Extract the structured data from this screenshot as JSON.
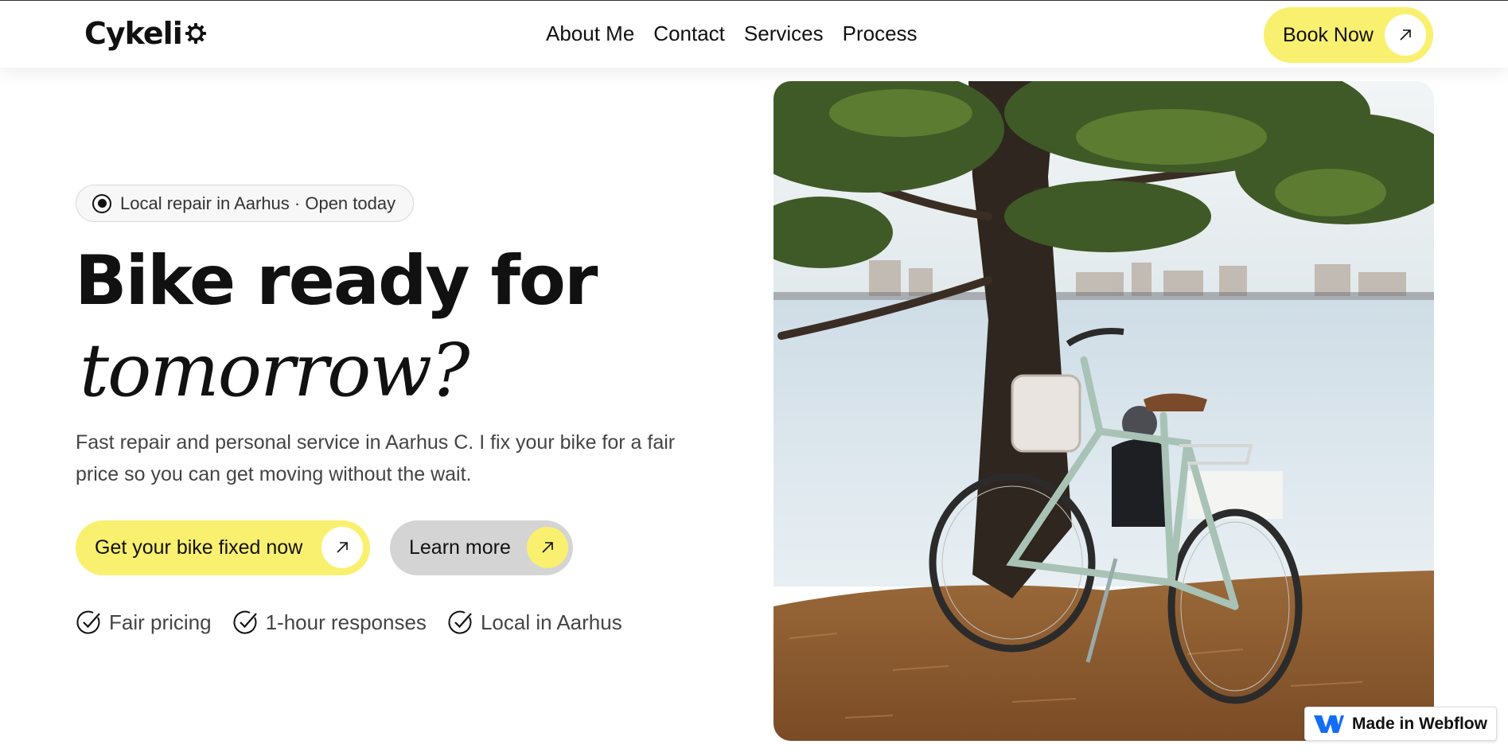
{
  "header": {
    "logo": "Cykeli",
    "nav": [
      "About Me",
      "Contact",
      "Services",
      "Process"
    ],
    "book_label": "Book Now"
  },
  "hero": {
    "pill_text": "Local repair in Aarhus · Open today",
    "title_line1": "Bike ready for",
    "title_line2": "tomorrow?",
    "description": "Fast repair and personal service in Aarhus C. I fix your bike for a fair price so you can get moving without the wait.",
    "cta_primary": "Get your bike fixed now",
    "cta_secondary": "Learn more",
    "features": [
      "Fair pricing",
      "1-hour responses",
      "Local in Aarhus"
    ]
  },
  "badge": {
    "label": "Made in Webflow"
  },
  "colors": {
    "accent": "#f9f06f",
    "secondary_button": "#d4d4d4",
    "text": "#111111",
    "muted": "#444444"
  },
  "icons": {
    "logo_mark": "gear-icon",
    "arrow": "arrow-up-right-icon",
    "pill": "radio-icon",
    "features": "check-circle-icon",
    "badge": "webflow-logo-icon"
  }
}
